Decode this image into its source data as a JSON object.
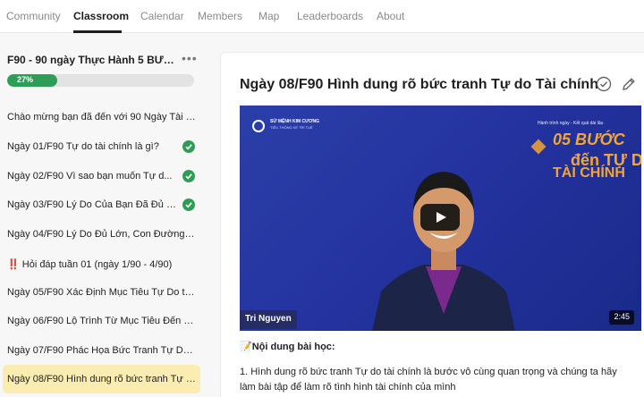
{
  "nav": {
    "tabs": [
      "Community",
      "Classroom",
      "Calendar",
      "Members",
      "Map",
      "Leaderboards",
      "About"
    ],
    "active_tab": "Classroom"
  },
  "sidebar": {
    "course_title": "F90 - 90 ngày Thực Hành 5 BƯỚ...",
    "more_icon": "ellipsis-icon",
    "progress": {
      "percent": 27,
      "label": "27%"
    },
    "lessons": [
      {
        "label": "Chào mừng bạn đã đến với 90 Ngày Tài C...",
        "completed": false,
        "active": false
      },
      {
        "label": "Ngày 01/F90 Tự do tài chính là gì?",
        "completed": true,
        "active": false
      },
      {
        "label": "Ngày 02/F90 Vì sao bạn muốn Tự d...",
        "completed": true,
        "active": false
      },
      {
        "label": "Ngày 03/F90 Lý Do Của Bạn Đã Đủ L...",
        "completed": true,
        "active": false
      },
      {
        "label": "Ngày 04/F90 Lý Do Đủ Lớn, Con Đường M...",
        "completed": false,
        "active": false
      },
      {
        "label": "‼️ Hỏi đáp tuần 01 (ngày 1/90 - 4/90)",
        "completed": false,
        "active": false
      },
      {
        "label": "Ngày 05/F90 Xác Định Mục Tiêu Tự Do tài...",
        "completed": false,
        "active": false
      },
      {
        "label": "Ngày 06/F90 Lộ Trình Từ Mục Tiêu Đến H...",
        "completed": false,
        "active": false
      },
      {
        "label": "Ngày 07/F90 Phác Họa Bức Tranh Tự Do ...",
        "completed": false,
        "active": false
      },
      {
        "label": "Ngày 08/F90 Hình dung rõ bức tranh Tự d...",
        "completed": false,
        "active": true
      }
    ]
  },
  "main": {
    "title": "Ngày 08/F90 Hình dung rõ bức tranh Tự do Tài chính",
    "icons": [
      "check-circle-icon",
      "edit-pencil-icon"
    ],
    "video": {
      "brand": "SỨ MỆNH KIM CƯƠNG",
      "brand_sub": "TIÊU THÔNG KẾ TRÍ TUỆ",
      "tagline": "Hành trình ngày - Kết quả dài lâu",
      "title_line1": "05 BƯỚC",
      "title_line2": "đến TỰ DO",
      "title_line3": "TÀI CHÍNH",
      "presenter": "Tri Nguyen",
      "duration": "2:45",
      "accent_color": "#f3a632",
      "background_color": "#2433a0"
    },
    "content_heading": "📝Nội dung bài học:",
    "content_body": "1. Hình dung rõ bức tranh Tự do tài chính là bước vô cùng quan trọng và chúng ta hãy làm bài tập để làm rõ tình hình tài chính của mình"
  }
}
